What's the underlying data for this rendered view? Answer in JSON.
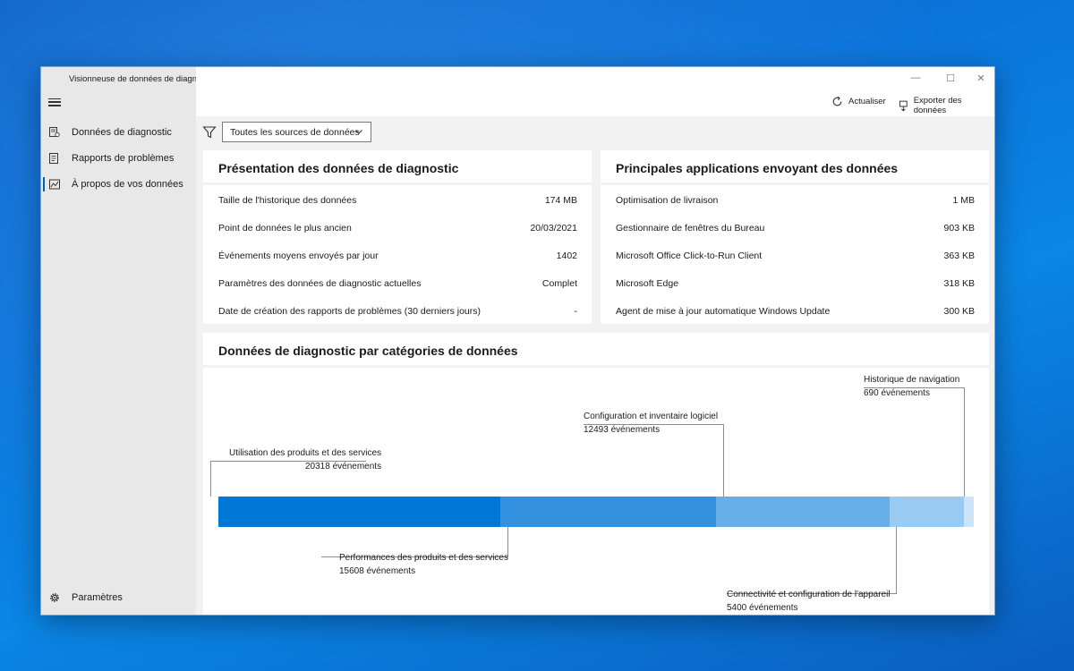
{
  "app": {
    "title": "Visionneuse de données de diagnostic"
  },
  "window_controls": {
    "minimize": "—",
    "maximize": "☐",
    "close": "✕"
  },
  "sidebar": {
    "items": [
      {
        "label": "Données de diagnostic",
        "icon": "diagnostic-data-icon"
      },
      {
        "label": "Rapports de problèmes",
        "icon": "problem-reports-icon"
      },
      {
        "label": "À propos de vos données",
        "icon": "chart-icon",
        "active": true
      }
    ],
    "settings_label": "Paramètres"
  },
  "toolbar": {
    "refresh_label": "Actualiser",
    "export_label": "Exporter des données"
  },
  "filter": {
    "selected": "Toutes les sources de données"
  },
  "overview": {
    "title": "Présentation des données de diagnostic",
    "rows": [
      {
        "label": "Taille de l'historique des données",
        "value": "174 MB"
      },
      {
        "label": "Point de données le plus ancien",
        "value": "20/03/2021"
      },
      {
        "label": "Événements moyens envoyés par jour",
        "value": "1402"
      },
      {
        "label": "Paramètres des données de diagnostic actuelles",
        "value": "Complet"
      },
      {
        "label": "Date de création des rapports de problèmes (30 derniers jours)",
        "value": "-"
      }
    ]
  },
  "top_apps": {
    "title": "Principales applications envoyant des données",
    "rows": [
      {
        "label": "Optimisation de livraison",
        "value": "1 MB"
      },
      {
        "label": "Gestionnaire de fenêtres du Bureau",
        "value": "903 KB"
      },
      {
        "label": "Microsoft Office Click-to-Run Client",
        "value": "363 KB"
      },
      {
        "label": "Microsoft Edge",
        "value": "318 KB"
      },
      {
        "label": "Agent de mise à jour automatique Windows Update",
        "value": "300 KB"
      }
    ]
  },
  "categories": {
    "title": "Données de diagnostic par catégories de données",
    "colors": [
      "#0078d7",
      "#3391e0",
      "#66aee8",
      "#99caf1",
      "#cce4f8"
    ],
    "items": [
      {
        "name": "Utilisation des produits et des services",
        "count": "20318 événements",
        "value": 20318
      },
      {
        "name": "Performances des produits et des services",
        "count": "15608 événements",
        "value": 15608
      },
      {
        "name": "Configuration et inventaire logiciel",
        "count": "12493 événements",
        "value": 12493
      },
      {
        "name": "Connectivité et configuration de l'appareil",
        "count": "5400 événements",
        "value": 5400
      },
      {
        "name": "Historique de navigation",
        "count": "690 événements",
        "value": 690
      }
    ]
  }
}
